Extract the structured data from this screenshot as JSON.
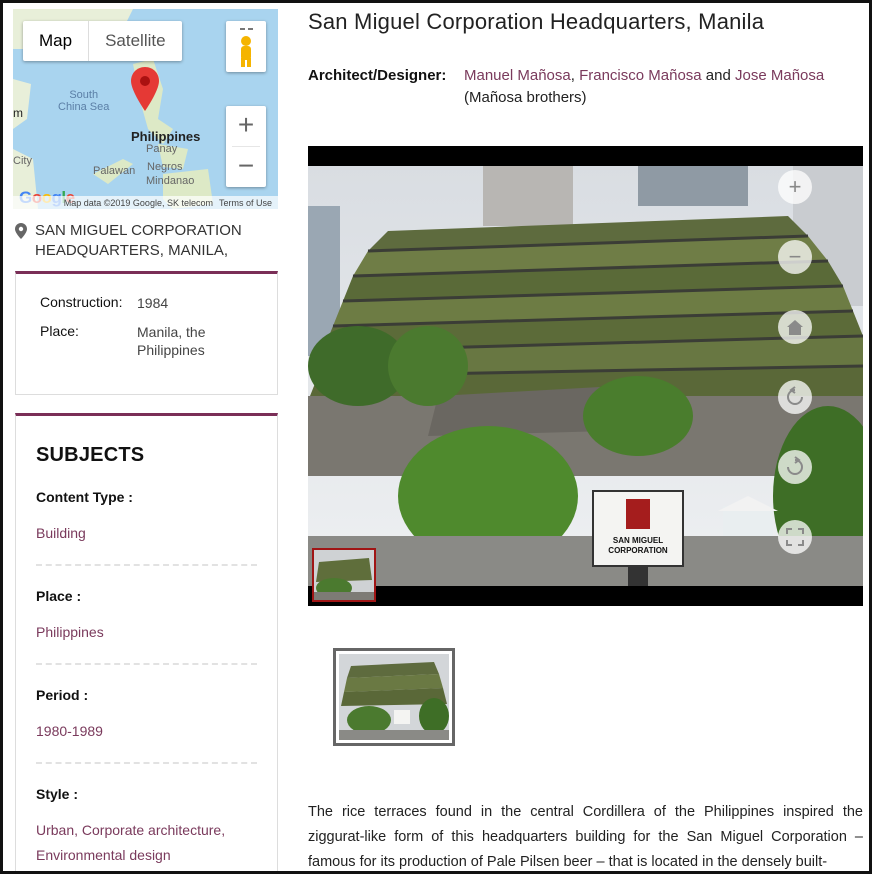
{
  "map": {
    "tabs": [
      "Map",
      "Satellite"
    ],
    "zoom_in": "+",
    "zoom_out": "−",
    "labels": {
      "sea": "South\nChina Sea",
      "country": "Philippines",
      "panay": "Panay",
      "negros": "Negros",
      "palawan": "Palawan",
      "mindanao": "Mindanao",
      "left_partial_1": "m",
      "left_partial_2": "City"
    },
    "footer_data": "Map data ©2019 Google, SK telecom",
    "footer_terms": "Terms of Use",
    "logo": "Google"
  },
  "address": "San Miguel Corporation Headquarters, Manila,",
  "info": {
    "construction_label": "Construction:",
    "construction_value": "1984",
    "place_label": "Place:",
    "place_value": "Manila, the Philippines"
  },
  "subjects": {
    "heading": "SUBJECTS",
    "items": [
      {
        "label": "Content Type :",
        "value": "Building"
      },
      {
        "label": "Place :",
        "value": "Philippines"
      },
      {
        "label": "Period :",
        "value": "1980-1989"
      },
      {
        "label": "Style :",
        "value": "Urban, Corporate architecture, Environmental design"
      }
    ]
  },
  "page": {
    "title": "San Miguel Corporation Headquarters, Manila",
    "architect_label": "Architect/Designer:",
    "architects": [
      "Manuel Mañosa",
      "Francisco Mañosa",
      "Jose Mañosa"
    ],
    "architect_sep1": ", ",
    "architect_and": " and ",
    "architect_note": "(Mañosa brothers)",
    "sign_text": "SAN MIGUEL CORPORATION",
    "description": "The rice terraces found in the central Cordillera of the Philippines inspired the ziggurat-like form of this headquarters building for the San Miguel Corporation – famous for its production of Pale Pilsen beer – that is located in the densely built-"
  },
  "viewer_controls": [
    "zoom-in",
    "zoom-out",
    "home",
    "rotate-left",
    "rotate-right",
    "fullscreen"
  ],
  "colors": {
    "accent": "#7a2e57",
    "link": "#7a3a5c"
  }
}
